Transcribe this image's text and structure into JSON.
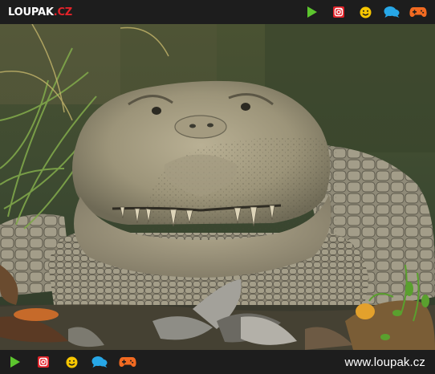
{
  "header": {
    "logo_main": "LOUPAK",
    "logo_tld": ".CZ"
  },
  "icons": [
    "play-icon",
    "instagram-icon",
    "smiley-icon",
    "chat-bubbles-icon",
    "gamepad-icon"
  ],
  "colors": {
    "bar_bg": "#1d1d1d",
    "play": "#5cc52e",
    "instagram": "#e2232a",
    "smiley": "#f7c600",
    "chat": "#27a7e7",
    "gamepad": "#f26a21",
    "logo_accent": "#e2232a"
  },
  "photo": {
    "subject": "crocodile-photo"
  },
  "footer": {
    "site_url": "www.loupak.cz"
  }
}
